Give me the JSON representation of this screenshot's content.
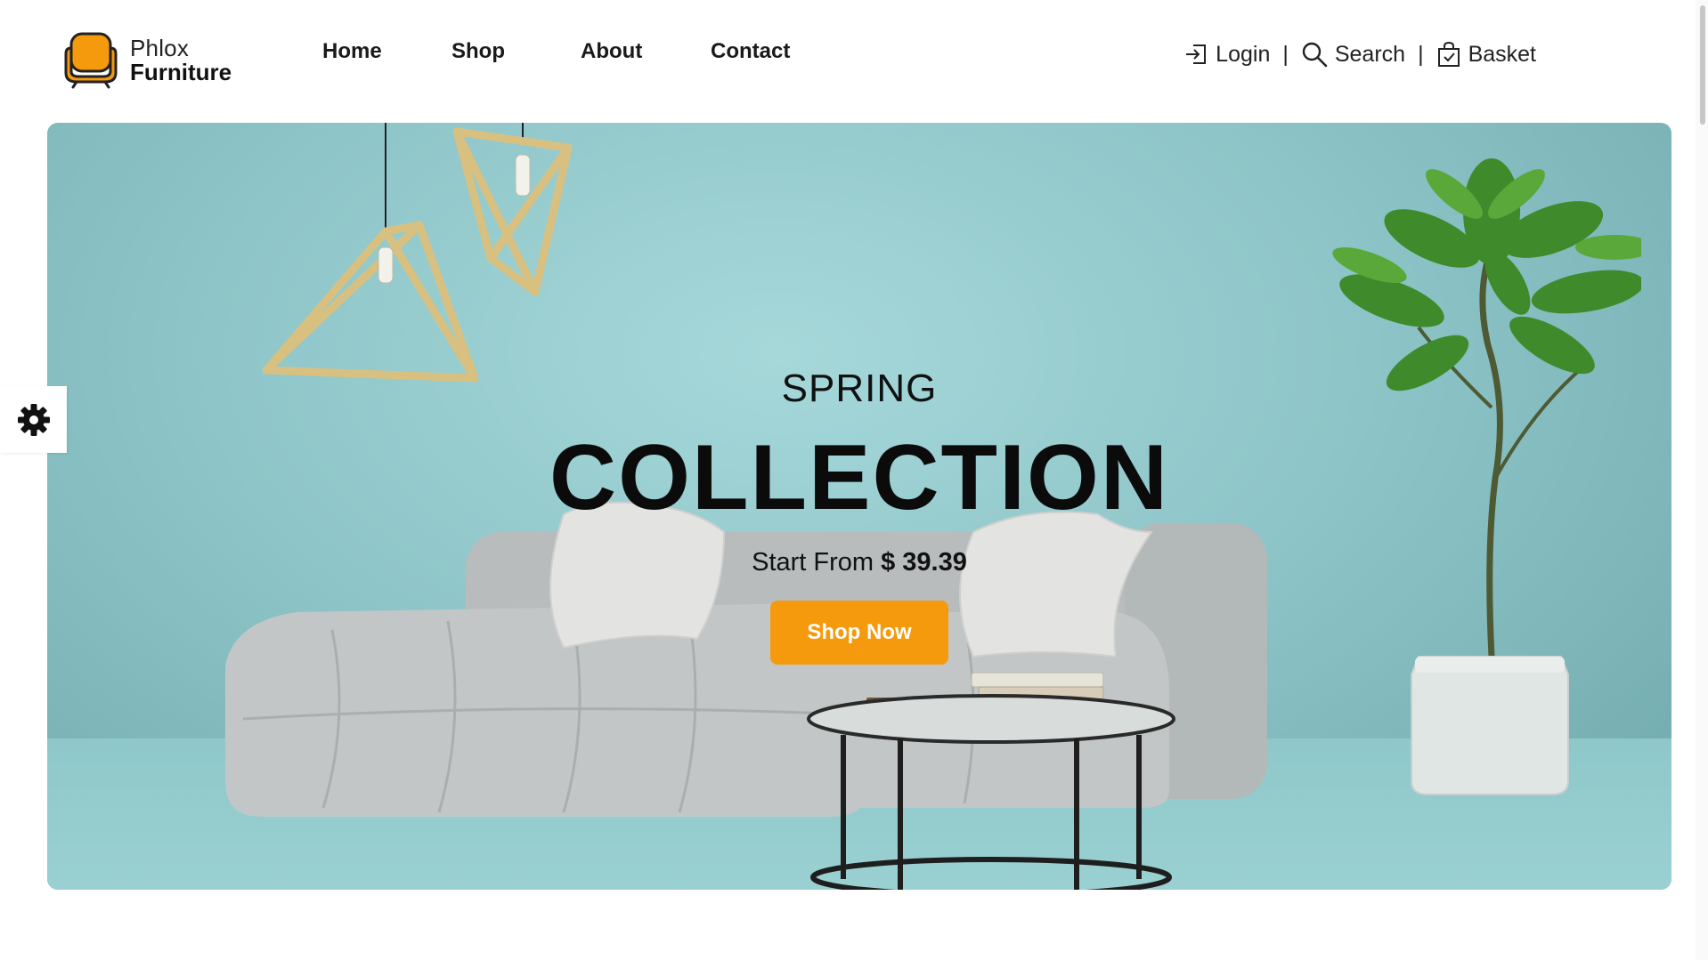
{
  "brand": {
    "name_line1": "Phlox",
    "name_line2": "Furniture",
    "logo_icon": "armchair-icon",
    "accent_color": "#f59a0c"
  },
  "nav": {
    "items": [
      {
        "label": "Home"
      },
      {
        "label": "Shop"
      },
      {
        "label": "About"
      },
      {
        "label": "Contact"
      }
    ]
  },
  "utility": {
    "login_label": "Login",
    "login_icon": "login-arrow-icon",
    "search_label": "Search",
    "search_icon": "search-icon",
    "basket_label": "Basket",
    "basket_icon": "shopping-bag-icon",
    "separator": "|"
  },
  "hero": {
    "eyebrow": "SPRING",
    "headline": "COLLECTION",
    "price_prefix": "Start From",
    "price_value": "$ 39.39",
    "cta_label": "Shop Now",
    "background_color": "#8ec5c8"
  },
  "settings": {
    "icon": "gear-icon"
  }
}
